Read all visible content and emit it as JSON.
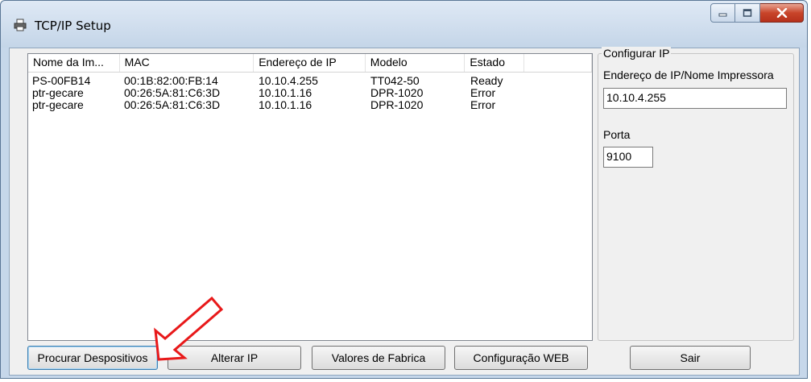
{
  "window": {
    "title": "TCP/IP Setup",
    "icon": "printer-icon"
  },
  "list": {
    "columns": [
      "Nome da Im...",
      "MAC",
      "Endereço de IP",
      "Modelo",
      "Estado",
      ""
    ],
    "rows": [
      [
        "PS-00FB14",
        "00:1B:82:00:FB:14",
        "10.10.4.255",
        "TT042-50",
        "Ready"
      ],
      [
        "ptr-gecare",
        "00:26:5A:81:C6:3D",
        "10.10.1.16",
        "DPR-1020",
        "Error"
      ],
      [
        "ptr-gecare",
        "00:26:5A:81:C6:3D",
        "10.10.1.16",
        "DPR-1020",
        "Error"
      ]
    ]
  },
  "config": {
    "group_title": "Configurar IP",
    "ip_label": "Endereço de IP/Nome Impressora",
    "ip_value": "10.10.4.255",
    "port_label": "Porta",
    "port_value": "9100"
  },
  "buttons": {
    "search": "Procurar Despositivos",
    "change_ip": "Alterar IP",
    "factory": "Valores de Fabrica",
    "web": "Configuração WEB",
    "exit": "Sair"
  },
  "colors": {
    "annotation_arrow": "#e8191a",
    "close_button": "#c8452a"
  }
}
